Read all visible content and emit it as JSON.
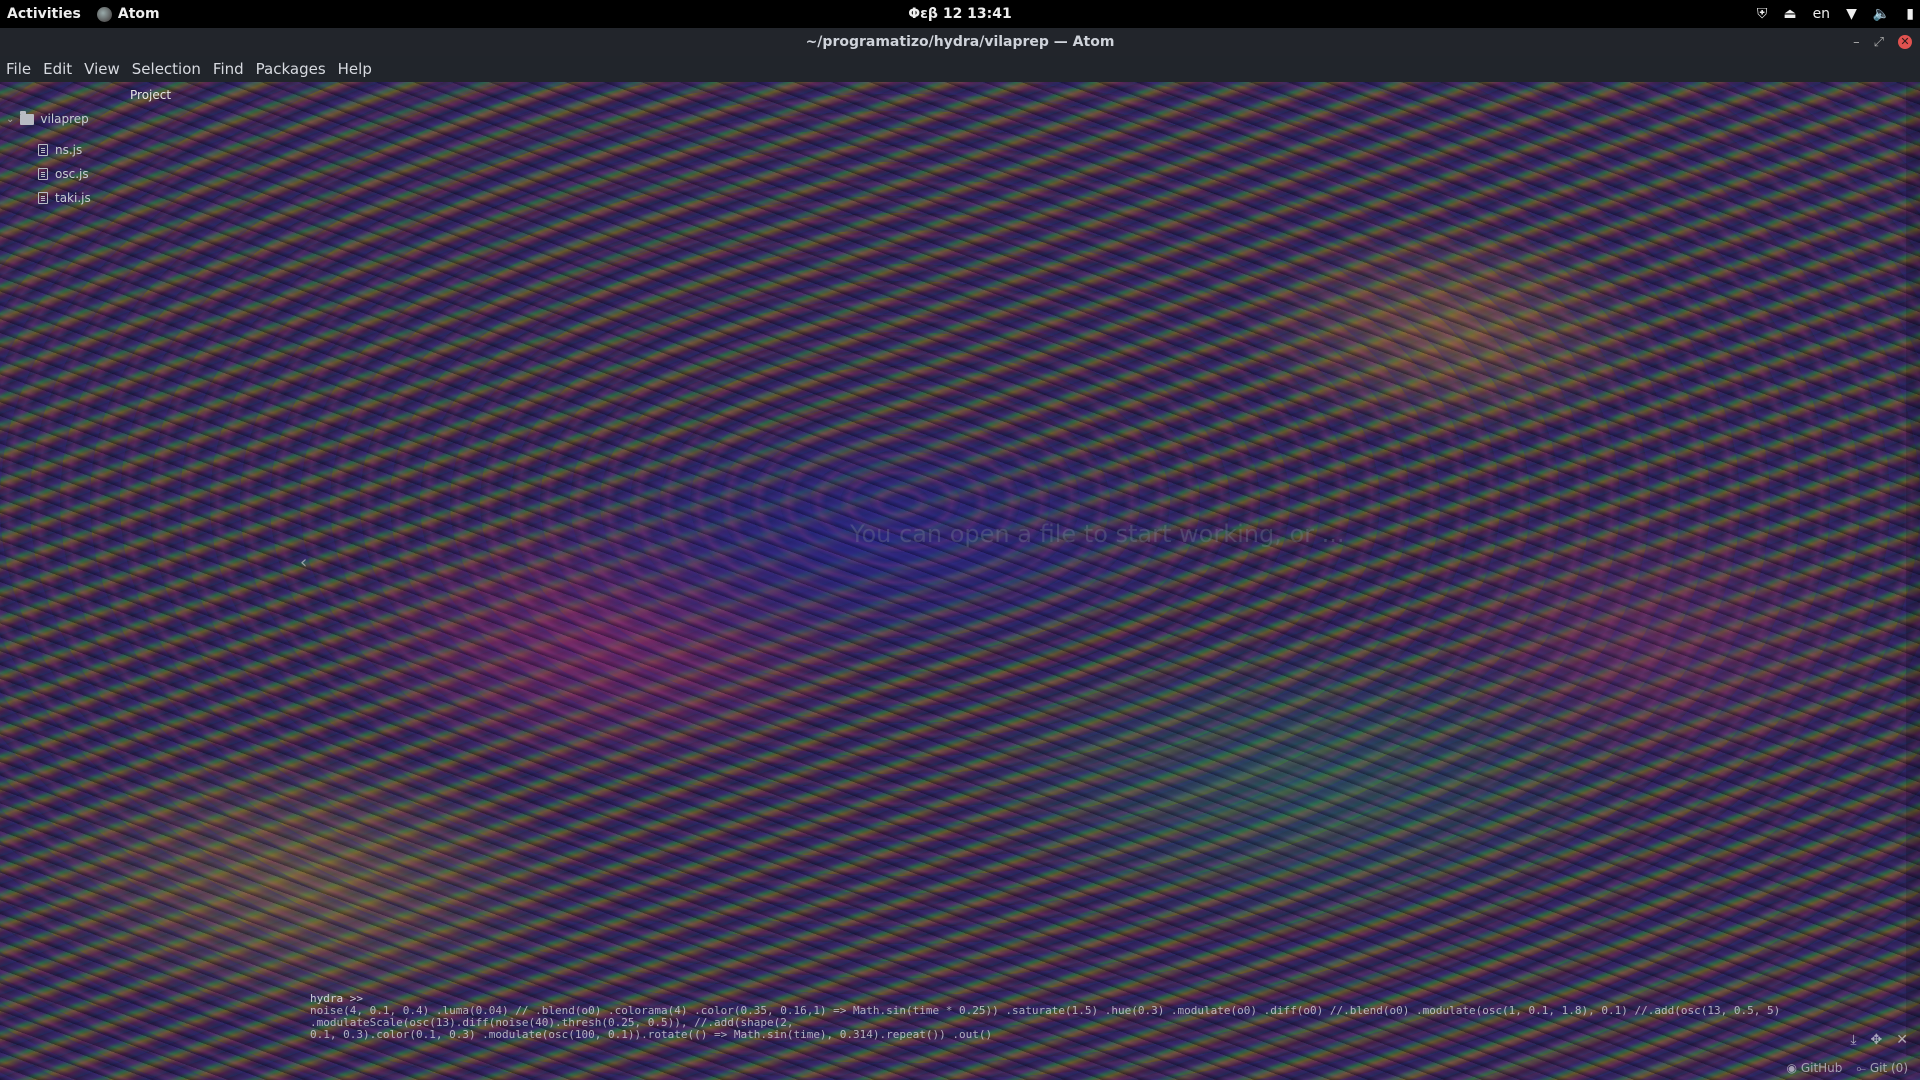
{
  "topbar": {
    "activities": "Activities",
    "app_name": "Atom",
    "clock": "Φεβ 12  13:41",
    "lang": "en",
    "tray_icons": [
      "shield-icon",
      "eject-icon",
      "wifi-icon",
      "volume-icon",
      "battery-icon"
    ]
  },
  "window": {
    "title": "~/programatizo/hydra/vilaprep — Atom",
    "controls": [
      "minimize-icon",
      "maximize-icon",
      "close-icon"
    ]
  },
  "menu": [
    "File",
    "Edit",
    "View",
    "Selection",
    "Find",
    "Packages",
    "Help"
  ],
  "tree": {
    "panel_title": "Project",
    "root": "vilaprep",
    "files": [
      "ns.js",
      "osc.js",
      "taki.js"
    ]
  },
  "center_hint": "You can open a file to start working, or ...",
  "hydra": {
    "prompt": "hydra >>",
    "code_line_1": "noise(4, 0.1, 0.4) .luma(0.04) // .blend(o0) .colorama(4) .color(0.35, 0.16,1) => Math.sin(time * 0.25)) .saturate(1.5) .hue(0.3) .modulate(o0) .diff(o0) //.blend(o0) .modulate(osc(1, 0.1, 1.8), 0.1) //.add(osc(13, 0.5, 5) .modulateScale(osc(13).diff(noise(40).thresh(0.25, 0.5)), //.add(shape(2,",
    "code_line_2": "0.1, 0.3).color(0.1, 0.3) .modulate(osc(100, 0.1)).rotate(() => Math.sin(time), 0.314).repeat()) .out()"
  },
  "statusbar": {
    "github": "GitHub",
    "git": "Git (0)"
  }
}
